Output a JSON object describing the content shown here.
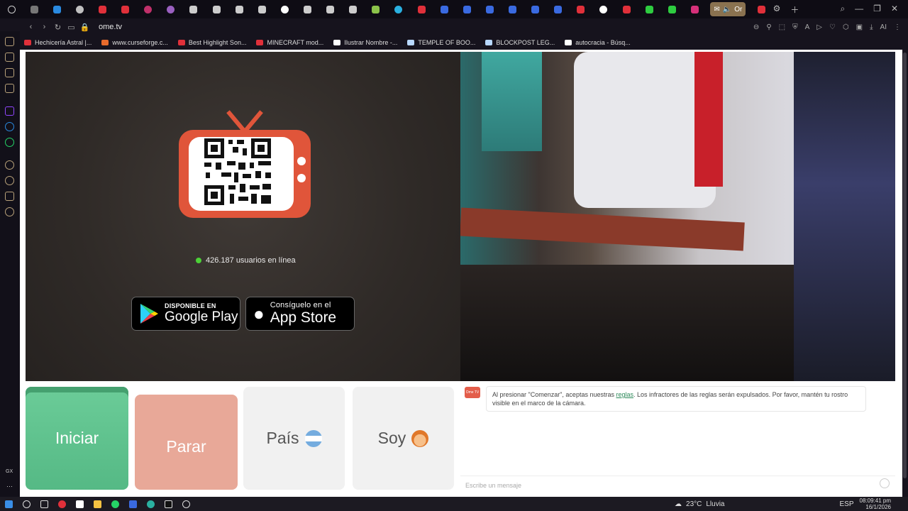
{
  "browser": {
    "active_tab_label": "Or",
    "url": "ome.tv",
    "bookmarks": [
      {
        "label": "Hechicería Astral |...",
        "color": "#e0303a"
      },
      {
        "label": "www.curseforge.c...",
        "color": "#e86b2c"
      },
      {
        "label": "Best Highlight Son...",
        "color": "#e0303a"
      },
      {
        "label": "MINECRAFT mod...",
        "color": "#e0303a"
      },
      {
        "label": "Ilustrar Nombre -...",
        "color": "#ffffff"
      },
      {
        "label": "TEMPLE OF BOO...",
        "color": "#b8d8ff"
      },
      {
        "label": "BLOCKPOST LEG...",
        "color": "#b8d8ff"
      },
      {
        "label": "autocracia - Búsq...",
        "color": "#ffffff"
      }
    ]
  },
  "left_panel": {
    "online_text": "426.187 usuarios en línea",
    "google_play": {
      "small": "DISPONIBLE EN",
      "big": "Google Play"
    },
    "app_store": {
      "small": "Consíguelo en el",
      "big": "App Store"
    }
  },
  "controls": {
    "start": "Iniciar",
    "stop": "Parar",
    "country": "País",
    "gender": "Soy"
  },
  "chat": {
    "logo": "Ome TV",
    "notice_before": "Al presionar \"Comenzar\", aceptas nuestras ",
    "notice_link": "reglas",
    "notice_after": ". Los infractores de las reglas serán expulsados. Por favor, mantén tu rostro visible en el marco de la cámara.",
    "placeholder": "Escribe un mensaje"
  },
  "taskbar": {
    "temperature": "23°C",
    "weather": "Lluvia",
    "language": "ESP",
    "time": "08:09:41 pm",
    "date": "16/1/2026"
  },
  "colors": {
    "start_button": "#5fc28f",
    "stop_button": "#e8a898",
    "tv_orange": "#e0553a",
    "online_dot": "#4cd137"
  }
}
